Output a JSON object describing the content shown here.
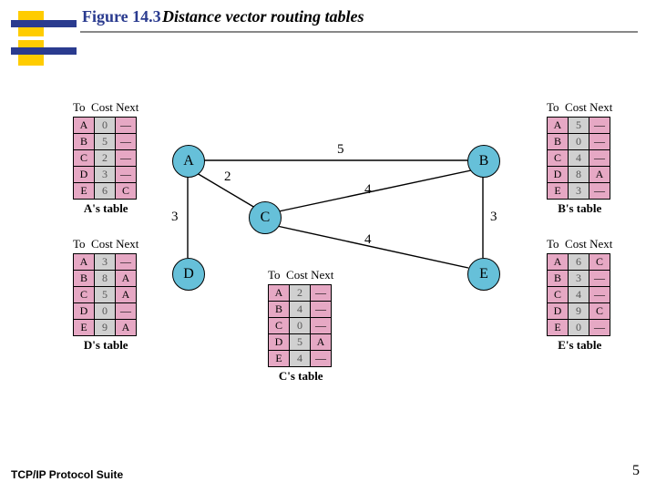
{
  "header": {
    "figure_label": "Figure 14.3",
    "figure_title": "Distance vector routing tables"
  },
  "footer": {
    "left": "TCP/IP Protocol Suite",
    "page": "5"
  },
  "table_header": {
    "to": "To",
    "cost": "Cost",
    "next": "Next"
  },
  "tables": {
    "A": {
      "caption": "A's table",
      "rows": [
        {
          "to": "A",
          "cost": "0",
          "next": "—"
        },
        {
          "to": "B",
          "cost": "5",
          "next": "—"
        },
        {
          "to": "C",
          "cost": "2",
          "next": "—"
        },
        {
          "to": "D",
          "cost": "3",
          "next": "—"
        },
        {
          "to": "E",
          "cost": "6",
          "next": "C"
        }
      ]
    },
    "B": {
      "caption": "B's table",
      "rows": [
        {
          "to": "A",
          "cost": "5",
          "next": "—"
        },
        {
          "to": "B",
          "cost": "0",
          "next": "—"
        },
        {
          "to": "C",
          "cost": "4",
          "next": "—"
        },
        {
          "to": "D",
          "cost": "8",
          "next": "A"
        },
        {
          "to": "E",
          "cost": "3",
          "next": "—"
        }
      ]
    },
    "C": {
      "caption": "C's table",
      "rows": [
        {
          "to": "A",
          "cost": "2",
          "next": "—"
        },
        {
          "to": "B",
          "cost": "4",
          "next": "—"
        },
        {
          "to": "C",
          "cost": "0",
          "next": "—"
        },
        {
          "to": "D",
          "cost": "5",
          "next": "A"
        },
        {
          "to": "E",
          "cost": "4",
          "next": "—"
        }
      ]
    },
    "D": {
      "caption": "D's table",
      "rows": [
        {
          "to": "A",
          "cost": "3",
          "next": "—"
        },
        {
          "to": "B",
          "cost": "8",
          "next": "A"
        },
        {
          "to": "C",
          "cost": "5",
          "next": "A"
        },
        {
          "to": "D",
          "cost": "0",
          "next": "—"
        },
        {
          "to": "E",
          "cost": "9",
          "next": "A"
        }
      ]
    },
    "E": {
      "caption": "E's table",
      "rows": [
        {
          "to": "A",
          "cost": "6",
          "next": "C"
        },
        {
          "to": "B",
          "cost": "3",
          "next": "—"
        },
        {
          "to": "C",
          "cost": "4",
          "next": "—"
        },
        {
          "to": "D",
          "cost": "9",
          "next": "C"
        },
        {
          "to": "E",
          "cost": "0",
          "next": "—"
        }
      ]
    }
  },
  "nodes": {
    "A": "A",
    "B": "B",
    "C": "C",
    "D": "D",
    "E": "E"
  },
  "edges": {
    "AB": "5",
    "AC": "2",
    "AD": "3",
    "BC": "4",
    "BE": "3",
    "CE": "4"
  }
}
